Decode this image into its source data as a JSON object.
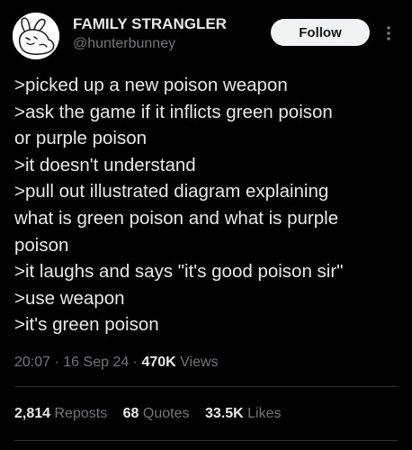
{
  "author": {
    "display_name": "FAMILY STRANGLER",
    "handle": "@hunterbunney",
    "avatar_icon": "bunny-doodle-avatar"
  },
  "actions": {
    "follow_label": "Follow",
    "more_icon": "more-vertical-icon"
  },
  "tweet": {
    "lines": [
      ">picked up a new poison weapon",
      ">ask the game if it inflicts green poison",
      "or purple poison",
      ">it doesn't understand",
      ">pull out illustrated diagram explaining",
      "what is green poison and what is purple",
      "poison",
      ">it laughs and says \"it's good poison sir\"",
      ">use weapon",
      ">it's green poison"
    ]
  },
  "meta": {
    "time": "20:07",
    "separator": "·",
    "date": "16 Sep 24",
    "views_count": "470K",
    "views_label": "Views"
  },
  "stats": {
    "reposts_count": "2,814",
    "reposts_label": "Reposts",
    "quotes_count": "68",
    "quotes_label": "Quotes",
    "likes_count": "33.5K",
    "likes_label": "Likes"
  },
  "colors": {
    "background": "#000000",
    "primary_text": "#e7e9ea",
    "secondary_text": "#71767b",
    "follow_button_bg": "#eff3f4",
    "divider": "#2f3336"
  }
}
